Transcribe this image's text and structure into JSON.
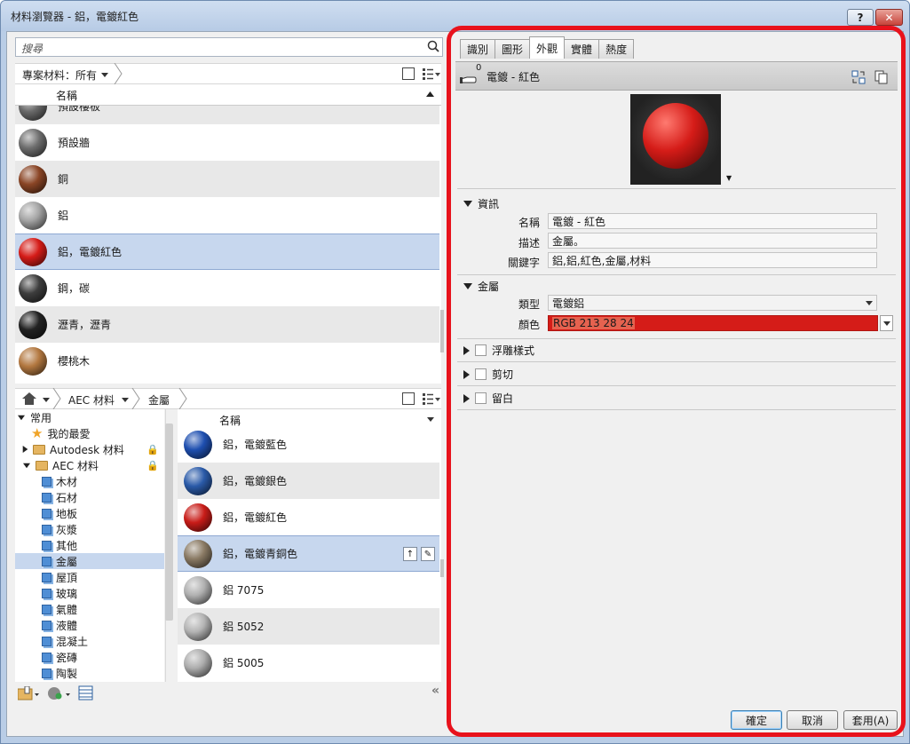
{
  "window": {
    "title": "材料瀏覽器 - 鋁，電鍍紅色",
    "help": "?",
    "close": "✕"
  },
  "search": {
    "placeholder": "搜尋"
  },
  "project": {
    "filter_label": "專案材料：所有",
    "column_name": "名稱",
    "materials": [
      {
        "name": "預設樓板",
        "color": "#6a6a6a"
      },
      {
        "name": "預設牆",
        "color": "#6e6e6e"
      },
      {
        "name": "銅",
        "color": "#8a4525"
      },
      {
        "name": "鋁",
        "color": "#a4a4a4"
      },
      {
        "name": "鋁，電鍍紅色",
        "color": "#d51c18"
      },
      {
        "name": "鋼，碳",
        "color": "#3d3d3d"
      },
      {
        "name": "瀝青，瀝青",
        "color": "#222222"
      },
      {
        "name": "櫻桃木",
        "color": "#b37840"
      }
    ],
    "selected": "鋁，電鍍紅色"
  },
  "library": {
    "breadcrumb": [
      "AEC 材料",
      "金屬"
    ],
    "tree": [
      {
        "label": "常用",
        "level": 0,
        "type": "expander"
      },
      {
        "label": "我的最愛",
        "level": 1,
        "type": "star"
      },
      {
        "label": "Autodesk 材料",
        "level": 1,
        "type": "folder"
      },
      {
        "label": "AEC 材料",
        "level": 1,
        "type": "folder"
      },
      {
        "label": "木材",
        "level": 2
      },
      {
        "label": "石材",
        "level": 2
      },
      {
        "label": "地板",
        "level": 2
      },
      {
        "label": "灰漿",
        "level": 2
      },
      {
        "label": "其他",
        "level": 2
      },
      {
        "label": "金屬",
        "level": 2
      },
      {
        "label": "屋頂",
        "level": 2
      },
      {
        "label": "玻璃",
        "level": 2
      },
      {
        "label": "氣體",
        "level": 2
      },
      {
        "label": "液體",
        "level": 2
      },
      {
        "label": "混凝土",
        "level": 2
      },
      {
        "label": "瓷磚",
        "level": 2
      },
      {
        "label": "陶製",
        "level": 2
      }
    ],
    "column_name": "名稱",
    "materials": [
      {
        "name": "鋁，電鍍藍色",
        "color": "#1e4fb0"
      },
      {
        "name": "鋁，電鍍銀色",
        "color": "#2a5aa8"
      },
      {
        "name": "鋁，電鍍紅色",
        "color": "#c81c18"
      },
      {
        "name": "鋁，電鍍青銅色",
        "color": "#8a7a64"
      },
      {
        "name": "鋁 7075",
        "color": "#b0b0b0"
      },
      {
        "name": "鋁 5052",
        "color": "#b4b4b4"
      },
      {
        "name": "鋁 5005",
        "color": "#adadad"
      }
    ],
    "selected": "鋁，電鍍青銅色"
  },
  "editor": {
    "tabs": [
      "識別",
      "圖形",
      "外觀",
      "實體",
      "熱度"
    ],
    "active_tab": "外觀",
    "asset_name": "電鍍 - 紅色",
    "asset_count": "0",
    "info": {
      "header": "資訊",
      "name_label": "名稱",
      "name_value": "電鍍 - 紅色",
      "desc_label": "描述",
      "desc_value": "金屬。",
      "keywords_label": "關鍵字",
      "keywords_value": "鋁,鋁,紅色,金屬,材料"
    },
    "metal": {
      "header": "金屬",
      "type_label": "類型",
      "type_value": "電鍍鋁",
      "color_label": "顏色",
      "color_value": "RGB 213 28 24",
      "color_hex": "#d51c18"
    },
    "sections": [
      "浮雕樣式",
      "剪切",
      "留白"
    ]
  },
  "buttons": {
    "ok": "確定",
    "cancel": "取消",
    "apply": "套用(A)"
  }
}
